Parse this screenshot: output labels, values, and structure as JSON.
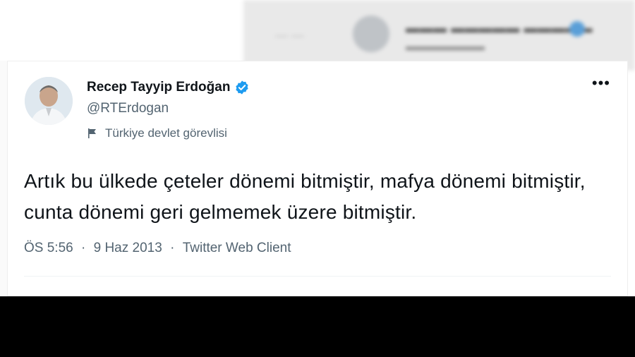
{
  "background_tweet": {
    "icon": "blurred-preview"
  },
  "tweet": {
    "author_name": "Recep Tayyip Erdoğan",
    "handle": "@RTErdogan",
    "account_label": "Türkiye devlet görevlisi",
    "more_label": "•••",
    "text": "Artık bu ülkede çeteler dönemi bitmiştir, mafya dönemi bitmiştir, cunta dönemi geri gelmemek üzere bitmiştir.",
    "time": "ÖS 5:56",
    "date": "9 Haz 2013",
    "separator": "·",
    "client": "Twitter Web Client"
  },
  "colors": {
    "verified_badge": "#1d9bf0",
    "text_primary": "#0f1419",
    "text_secondary": "#536471"
  }
}
